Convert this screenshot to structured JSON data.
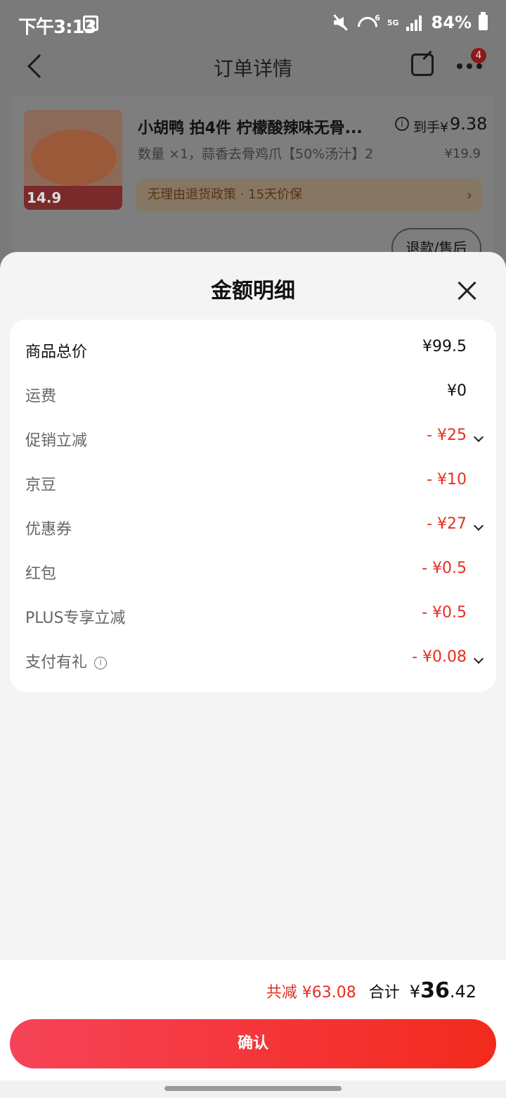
{
  "status_bar": {
    "time": "下午3:13",
    "wifi_label": "6",
    "network": "5G",
    "battery": "84%"
  },
  "nav": {
    "title": "订单详情",
    "badge_count": "4"
  },
  "order": {
    "product_name": "小胡鸭 拍4件 柠檬酸辣味无骨...",
    "spec": "数量 ×1，蒜香去骨鸡爪【50%汤汁】2",
    "price_label": "到手¥",
    "price": "9.38",
    "original_price": "¥19.9",
    "image_price_tag": "14.9",
    "policy": "无理由退货政策 · 15天价保",
    "refund_label": "退款/售后"
  },
  "sheet": {
    "title": "金额明细",
    "rows": [
      {
        "label": "商品总价",
        "value": "¥99.5",
        "style": "strong"
      },
      {
        "label": "运费",
        "value": "¥0"
      },
      {
        "label": "促销立减",
        "value": "- ¥25",
        "red": true,
        "chevron": true
      },
      {
        "label": "京豆",
        "value": "- ¥10",
        "red": true
      },
      {
        "label": "优惠券",
        "value": "- ¥27",
        "red": true,
        "chevron": true
      },
      {
        "label": "红包",
        "value": "- ¥0.5",
        "red": true
      },
      {
        "label": "PLUS专享立减",
        "value": "- ¥0.5",
        "red": true
      },
      {
        "label": "支付有礼",
        "value": "- ¥0.08",
        "red": true,
        "chevron": true,
        "info": true
      }
    ],
    "discount_total": "共减 ¥63.08",
    "total_label": "合计",
    "total_yen": "¥",
    "total_int": "36",
    "total_dec": ".42",
    "confirm_label": "确认"
  },
  "colors": {
    "accent_red": "#e52f24",
    "button_gradient_start": "#f64358",
    "button_gradient_end": "#f32a1d"
  }
}
